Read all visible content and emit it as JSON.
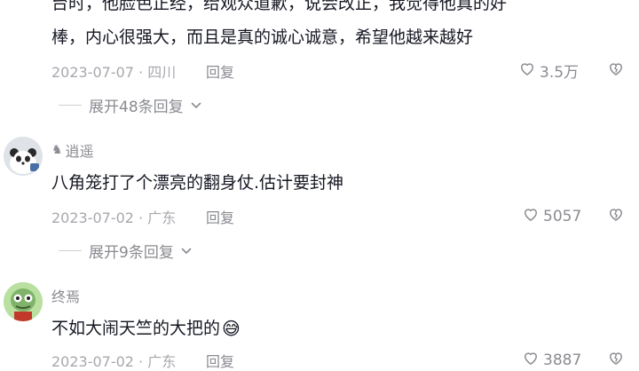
{
  "comments": [
    {
      "text_lines": [
        "台时，他脸色正经，给观众道歉，说会改正，我觉得他真的好",
        "棒，内心很强大，而且是真的诚心诚意，希望他越来越好"
      ],
      "date": "2023-07-07",
      "location": "四川",
      "reply_label": "回复",
      "likes": "3.5万",
      "expand_label": "展开48条回复"
    },
    {
      "username": "逍遥",
      "text": "八角笼打了个漂亮的翻身仗.估计要封神",
      "date": "2023-07-02",
      "location": "广东",
      "reply_label": "回复",
      "likes": "5057",
      "expand_label": "展开9条回复"
    },
    {
      "username": "终焉",
      "text": "不如大闹天竺的大把的",
      "emoji": "😅",
      "date": "2023-07-02",
      "location": "广东",
      "reply_label": "回复",
      "likes": "3887"
    }
  ]
}
